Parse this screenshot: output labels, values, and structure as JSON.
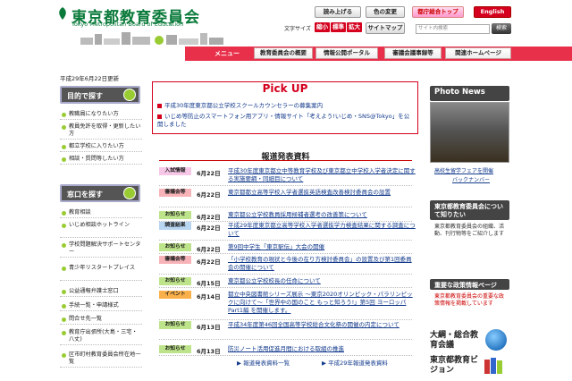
{
  "header": {
    "title_jp": "東京都教育委員会",
    "title_en": "Tokyo Metropolitan Board of Education",
    "buttons": {
      "read_aloud": "読み上げる",
      "color_change": "色の変更",
      "metro_top": "都庁総合トップ",
      "english": "English",
      "sitemap": "サイトマップ"
    },
    "font_size_label": "文字サイズ",
    "font_sizes": [
      "縮小",
      "標準",
      "拡大"
    ],
    "search_placeholder": "サイト内検索",
    "search_button": "検索"
  },
  "menu": {
    "label": "メニュー",
    "tabs": [
      "教育委員会の概要",
      "情報公開ポータル",
      "審議会議事録等",
      "関連ホームページ"
    ]
  },
  "updated": "平成29年6月22日更新",
  "left": {
    "purpose_title": "目的で探す",
    "purpose_items": [
      "教職員になりたい方",
      "教員免許を取得・更新したい方",
      "都立学校に入りたい方",
      "相談・質問等したい方"
    ],
    "counter_title": "窓口を探す",
    "counter_items": [
      "教育相談",
      "いじめ相談ホットライン",
      "学校問題解決サポートセンター",
      "青少年リスタートプレイス",
      "公益通報弁護士窓口",
      "手続一覧・申請様式",
      "問合せ先一覧",
      "教育庁出張所(大島・三宅・八丈)",
      "区市町村教育委員会所在地一覧"
    ]
  },
  "pickup": {
    "title": "Pick UP",
    "items": [
      "平成30年度東京都公立学校スクールカウンセラーの募集案内",
      "いじめ等防止のスマートフォン用アプリ・情報サイト「考えよう!いじめ・SNS@Tokyo」を公開しました"
    ]
  },
  "news": {
    "title": "報道発表資料",
    "items": [
      {
        "badge": "入試情報",
        "date": "6月22日",
        "text": "平成30年度東京都立中等教育学校及び東京都立中学校入学者決定に関する実施要綱・同細目について",
        "color": "#f7c7e8"
      },
      {
        "badge": "審議会等",
        "date": "6月22日",
        "text": "東京都都立高等学校入学者選抜英語検査改善検討委員会の設置",
        "color": "#f7b3b8"
      },
      {
        "badge": "お知らせ",
        "date": "6月22日",
        "text": "東京都公立学校教員採用候補者選考の改善策について",
        "color": "#bde48a"
      },
      {
        "badge": "調査結果",
        "date": "6月22日",
        "text": "平成29年度東京都立高等学校入学者選抜学力検査結果に関する調査について",
        "color": "#b8d6f2"
      },
      {
        "badge": "お知らせ",
        "date": "6月22日",
        "text": "第9回中学生「東京駅伝」大会の開催",
        "color": "#bde48a"
      },
      {
        "badge": "審議会等",
        "date": "6月22日",
        "text": "「小学校教育の現状と今後の在り方検討委員会」の設置及び第1回委員会の開催について",
        "color": "#f7b3b8"
      },
      {
        "badge": "お知らせ",
        "date": "6月15日",
        "text": "東京都公立学校校長の任命について",
        "color": "#bde48a"
      },
      {
        "badge": "イベント",
        "date": "6月14日",
        "text": "都立中央図書館シリーズ展示 ～東京2020オリンピック・パラリンピックに向けて～「世界中の国のこと もっと知ろう!」第5回 ヨーロッパPart1編 を開催します。",
        "color": "#f9b04a"
      },
      {
        "badge": "お知らせ",
        "date": "6月13日",
        "text": "平成34年度第46回全国高等学校総合文化祭の開催の内定について",
        "color": "#bde48a"
      },
      {
        "badge": "お知らせ",
        "date": "6月13日",
        "text": "防災ノート活用促進月間における取組の推進",
        "color": "#bde48a"
      }
    ],
    "list_link": "報道発表資料一覧",
    "year_link": "平成29年報道発表資料"
  },
  "right": {
    "photo_news_title": "Photo News",
    "photo_caption": "高校生留学フェアを開催",
    "backnumber": "バックナンバー",
    "about_title": "東京都教育委員会について知りたい",
    "about_text": "東京都教育委員会の組織、活動、刊行物等をご紹介します",
    "policy_title": "重要な政策情報ページ",
    "policy_text": "東京都教育委員会の重要な政策情報を掲載しています",
    "banner1": "大綱・総合教育会議",
    "banner2": "東京都教育ビジョン"
  }
}
